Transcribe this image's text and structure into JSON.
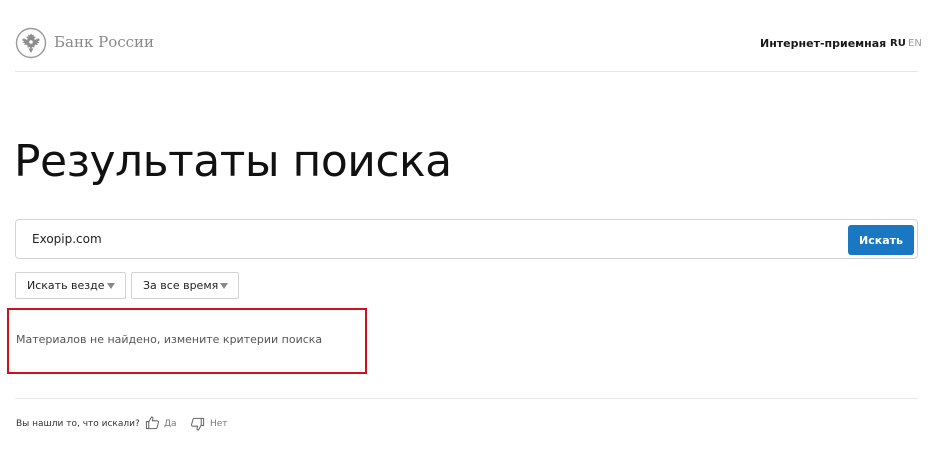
{
  "header": {
    "bank_name": "Банк России",
    "logo_icon": "double-headed-eagle-icon",
    "reception_link": "Интернет-приемная",
    "languages": {
      "ru": "RU",
      "en": "EN"
    }
  },
  "main": {
    "page_title": "Результаты поиска",
    "search": {
      "value": "Exopip.com",
      "button_label": "Искать",
      "button_color": "#1a78c2"
    },
    "filters": {
      "where": "Искать везде",
      "period": "За все время",
      "arrow_icon": "caret-down-icon"
    },
    "no_results_message": "Материалов не найдено, измените критерии поиска",
    "highlight_color": "#d0101a"
  },
  "feedback": {
    "question": "Вы нашли то, что искали?",
    "yes_label": "Да",
    "no_label": "Нет",
    "yes_icon": "thumb-up-icon",
    "no_icon": "thumb-down-icon"
  }
}
